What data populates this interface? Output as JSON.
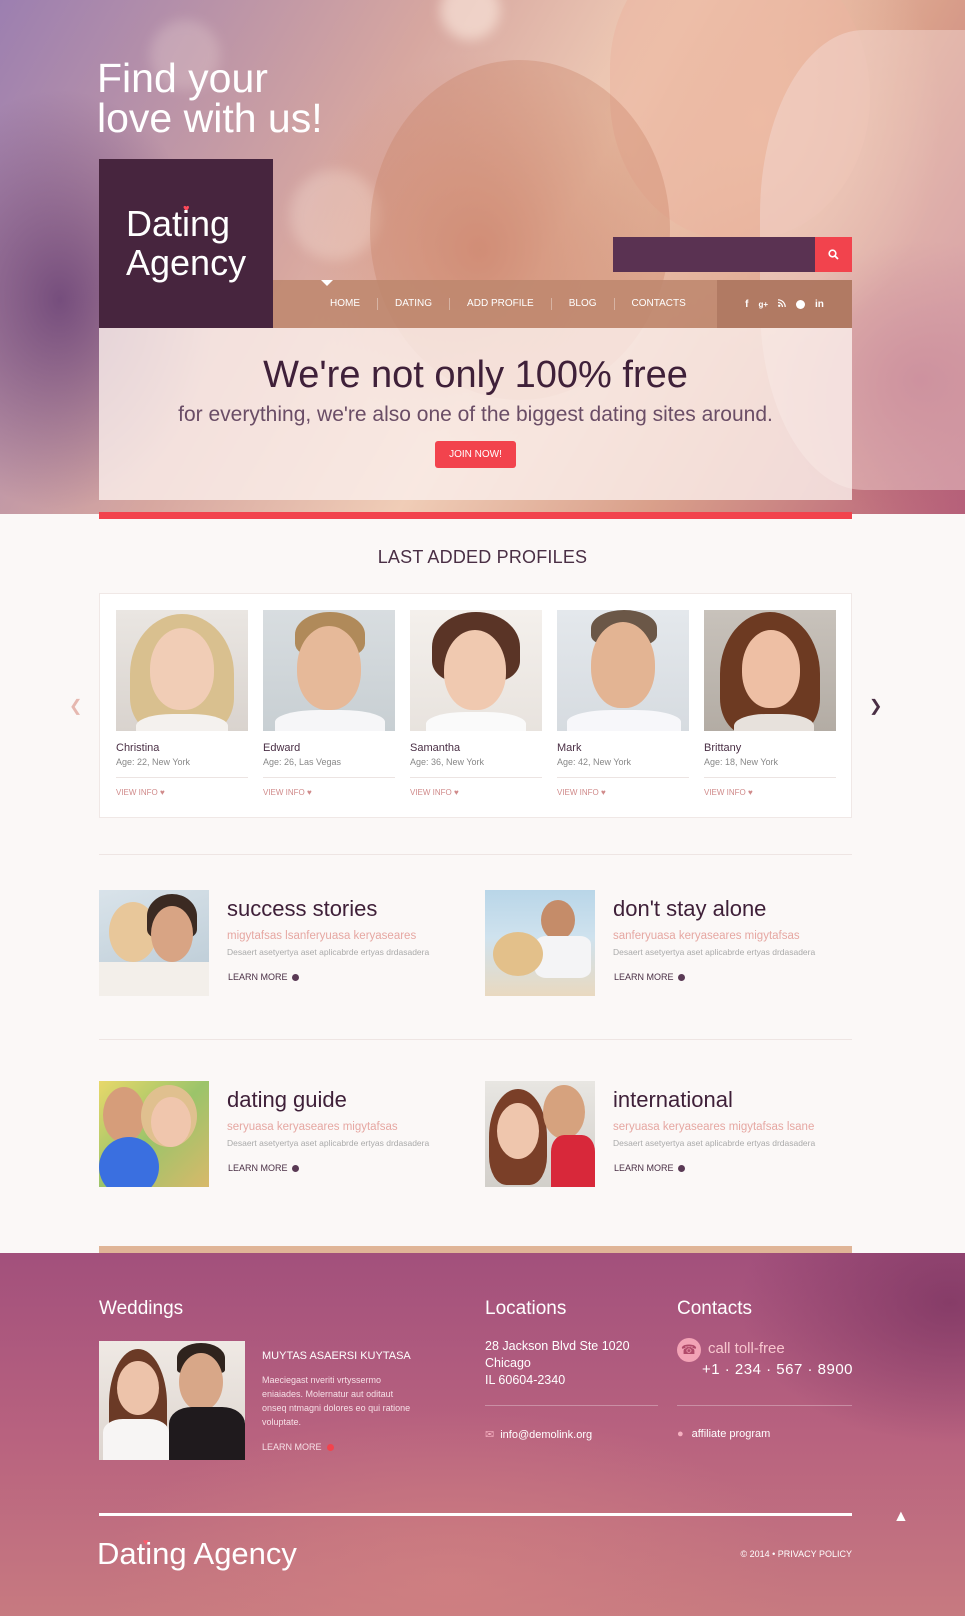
{
  "hero": {
    "title_line1": "Find your",
    "title_line2": "love with us!",
    "logo_line1": "Dating",
    "logo_line2": "Agency",
    "search_placeholder": ""
  },
  "nav": {
    "items": [
      "HOME",
      "DATING",
      "ADD PROFILE",
      "BLOG",
      "CONTACTS"
    ],
    "social": [
      "f",
      "g+",
      "rss",
      "p",
      "in"
    ]
  },
  "promo": {
    "title": "We're not only 100% free",
    "subtitle": "for everything, we're also one of the biggest dating sites around.",
    "button": "JOIN NOW!"
  },
  "profiles": {
    "heading": "LAST ADDED PROFILES",
    "link_label": "VIEW INFO",
    "items": [
      {
        "name": "Christina",
        "age": "Age: 22, New York"
      },
      {
        "name": "Edward",
        "age": "Age: 26, Las Vegas"
      },
      {
        "name": "Samantha",
        "age": "Age: 36, New York"
      },
      {
        "name": "Mark",
        "age": "Age: 42, New York"
      },
      {
        "name": "Brittany",
        "age": "Age: 18, New York"
      }
    ]
  },
  "features": [
    {
      "title": "success stories",
      "sub": "migytafsas lsanferyuasa keryaseares",
      "desc": "Desaert asetyertya aset aplicabrde ertyas drdasadera",
      "link": "LEARN MORE"
    },
    {
      "title": "don't stay alone",
      "sub": "sanferyuasa keryaseares migytafsas",
      "desc": "Desaert asetyertya aset aplicabrde ertyas drdasadera",
      "link": "LEARN MORE"
    },
    {
      "title": "dating guide",
      "sub": "seryuasa keryaseares migytafsas",
      "desc": "Desaert asetyertya aset aplicabrde ertyas drdasadera",
      "link": "LEARN MORE"
    },
    {
      "title": "international",
      "sub": "seryuasa keryaseares migytafsas lsane",
      "desc": "Desaert asetyertya aset aplicabrde ertyas drdasadera",
      "link": "LEARN MORE"
    }
  ],
  "footer": {
    "weddings_heading": "Weddings",
    "weddings_title": "MUYTAS ASAERSI KUYTASA",
    "weddings_text": "Maeciegast nveriti vrtyssermo eniaiades. Molernatur aut oditaut onseq ntmagni dolores eo qui ratione voluptate.",
    "weddings_link": "LEARN MORE",
    "locations_heading": "Locations",
    "address_line1": "28 Jackson Blvd Ste 1020",
    "address_line2": "Chicago",
    "address_line3": "IL 60604-2340",
    "email": "info@demolink.org",
    "contacts_heading": "Contacts",
    "call_label": "call toll-free",
    "phone": "+1 · 234 · 567 · 8900",
    "affiliate": "affiliate program",
    "logo": "Dating Agency",
    "copyright": "© 2014 •",
    "privacy": "PRIVACY POLICY"
  },
  "colors": {
    "accent": "#f2434d",
    "brand": "#47253e"
  }
}
